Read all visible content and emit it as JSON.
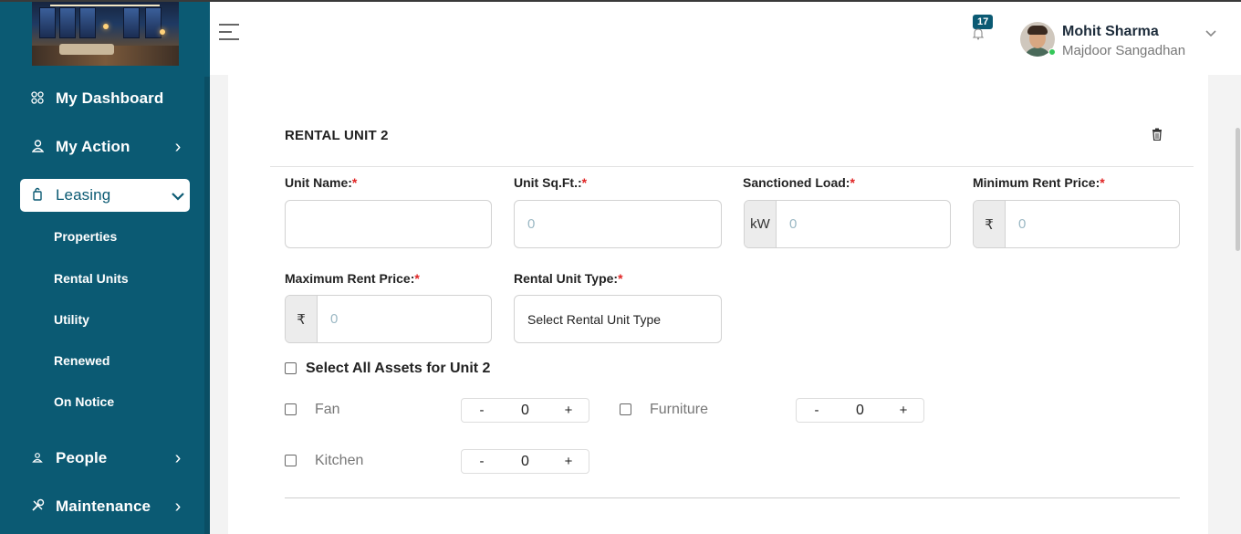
{
  "sidebar": {
    "nav": [
      {
        "label": "My Dashboard",
        "icon": "grid-icon",
        "chevron": ""
      },
      {
        "label": "My Action",
        "icon": "user-icon",
        "chevron": "›"
      },
      {
        "label": "Leasing",
        "icon": "lease-icon",
        "chevron": "⌄"
      },
      {
        "label": "People",
        "icon": "people-icon",
        "chevron": "›"
      },
      {
        "label": "Maintenance",
        "icon": "tools-icon",
        "chevron": "›"
      }
    ],
    "leasing_sub": [
      "Properties",
      "Rental Units",
      "Utility",
      "Renewed",
      "On Notice"
    ]
  },
  "header": {
    "notification_count": "17",
    "user_name": "Mohit Sharma",
    "user_org": "Majdoor Sangadhan"
  },
  "form": {
    "title": "RENTAL UNIT 2",
    "unit_name": {
      "label": "Unit Name:",
      "value": ""
    },
    "unit_sqft": {
      "label": "Unit Sq.Ft.:",
      "placeholder": "0"
    },
    "sanctioned_load": {
      "label": "Sanctioned Load:",
      "addon": "kW",
      "placeholder": "0"
    },
    "min_rent": {
      "label": "Minimum Rent Price:",
      "addon": "₹",
      "placeholder": "0"
    },
    "max_rent": {
      "label": "Maximum Rent Price:",
      "addon": "₹",
      "placeholder": "0"
    },
    "unit_type": {
      "label": "Rental Unit Type:",
      "value": "Select Rental Unit Type"
    },
    "required_mark": "*",
    "select_all_label": "Select All Assets for Unit 2",
    "assets": [
      {
        "label": "Fan",
        "qty": "0"
      },
      {
        "label": "Furniture",
        "qty": "0"
      },
      {
        "label": "Kitchen",
        "qty": "0"
      }
    ],
    "minus": "-",
    "plus": "+"
  }
}
